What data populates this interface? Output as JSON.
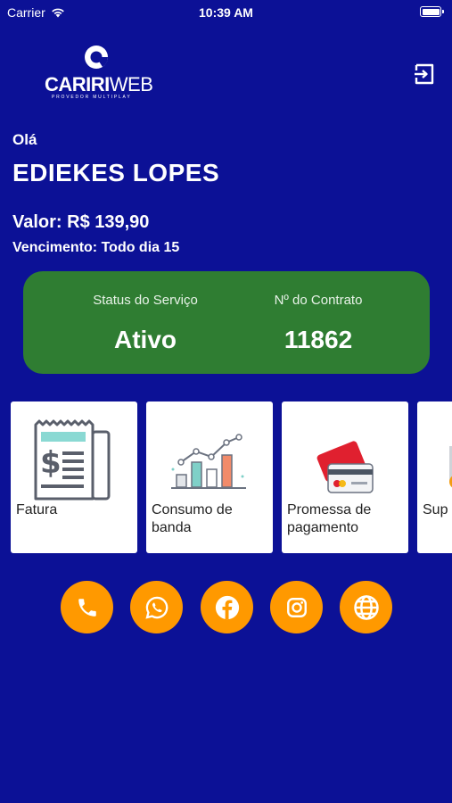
{
  "status_bar": {
    "carrier": "Carrier",
    "time": "10:39 AM"
  },
  "logo": {
    "brand_bold": "CARIRI",
    "brand_light": "WEB",
    "tagline": "PROVEDOR MULTIPLAY"
  },
  "header": {
    "logout_icon": "logout-icon"
  },
  "greeting": "Olá",
  "user_name": "EDIEKES LOPES",
  "billing": {
    "valor": "Valor: R$ 139,90",
    "vencimento": "Vencimento: Todo dia 15"
  },
  "status_card": {
    "color": "#2f7d32",
    "service_label": "Status do Serviço",
    "service_value": "Ativo",
    "contract_label": "Nº do Contrato",
    "contract_value": "11862"
  },
  "cards": [
    {
      "label": "Fatura",
      "icon": "invoice-icon"
    },
    {
      "label": "Consumo de banda",
      "icon": "bandwidth-chart-icon"
    },
    {
      "label": "Promessa de pagamento",
      "icon": "payment-cards-icon"
    },
    {
      "label": "Sup",
      "icon": "support-icon"
    }
  ],
  "social": [
    {
      "name": "phone",
      "icon": "phone-icon"
    },
    {
      "name": "whatsapp",
      "icon": "whatsapp-icon"
    },
    {
      "name": "facebook",
      "icon": "facebook-icon"
    },
    {
      "name": "instagram",
      "icon": "instagram-icon"
    },
    {
      "name": "website",
      "icon": "globe-icon"
    }
  ],
  "colors": {
    "background": "#0c1196",
    "accent": "#ff9900",
    "status_green": "#2f7d32"
  }
}
